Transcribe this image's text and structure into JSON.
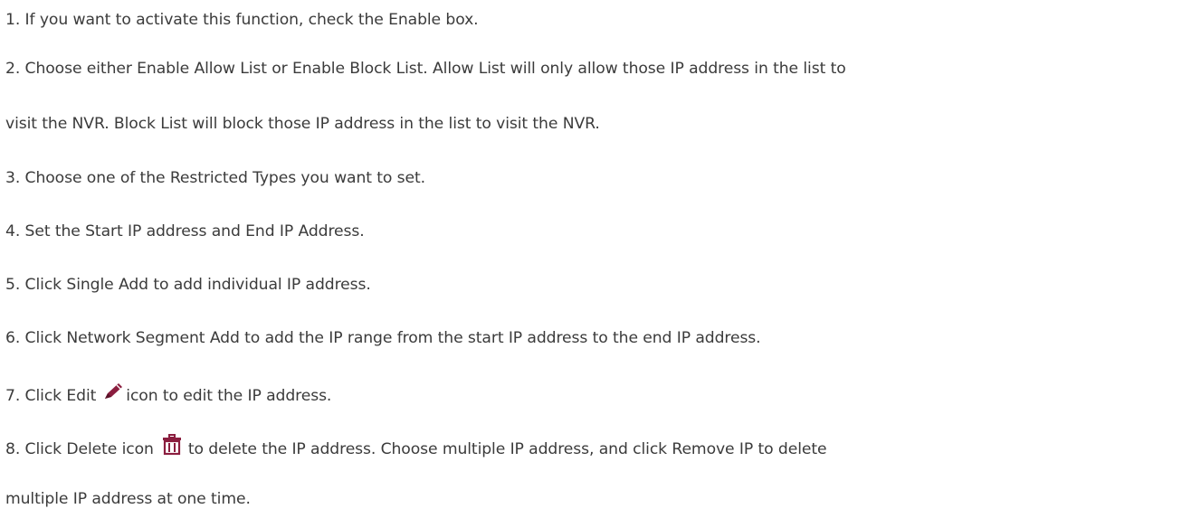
{
  "steps": {
    "s1": "1. If you want to activate this function, check the Enable box.",
    "s2_line1": "2. Choose either Enable Allow List or Enable Block List. Allow List will only allow those IP address in the list to",
    "s2_line2": "visit the NVR. Block List will block those IP address in the list to visit the NVR.",
    "s3": "3. Choose one of the Restricted Types you want to set.",
    "s4": "4. Set the Start IP address and End IP Address.",
    "s5": "5. Click Single Add to add individual IP address.",
    "s6": "6. Click Network Segment Add to add the IP range from the start IP address to the end IP address.",
    "s7_before": "7. Click Edit",
    "s7_after": "icon to edit the IP address.",
    "s8_before": "8. Click Delete icon",
    "s8_after": "to delete the IP address. Choose multiple IP address, and click Remove IP to delete",
    "s8_line2": "multiple IP address at one time."
  },
  "icons": {
    "edit": "pencil-icon",
    "delete": "trash-icon"
  },
  "colors": {
    "text": "#3b3b3b",
    "icon_accent": "#8b1e3f"
  }
}
